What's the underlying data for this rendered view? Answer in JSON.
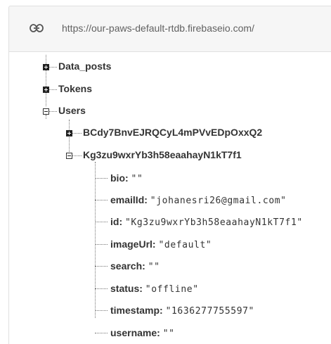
{
  "database": {
    "url": "https://our-paws-default-rtdb.firebaseio.com/"
  },
  "icons": {
    "url_link": "link-icon"
  },
  "tree": {
    "nodes": {
      "data_posts": "Data_posts",
      "tokens": "Tokens",
      "users": "Users",
      "user_1": "BCdy7BnvEJRQCyL4mPVvEDpOxxQ2",
      "user_2": "Kg3zu9wxrYb3h58eaahayN1kT7f1"
    },
    "fields": [
      {
        "key": "bio:",
        "value": "\"\""
      },
      {
        "key": "emailId:",
        "value": "\"johanesri26@gmail.com\""
      },
      {
        "key": "id:",
        "value": "\"Kg3zu9wxrYb3h58eaahayN1kT7f1\""
      },
      {
        "key": "imageUrl:",
        "value": "\"default\""
      },
      {
        "key": "search:",
        "value": "\"\""
      },
      {
        "key": "status:",
        "value": "\"offline\""
      },
      {
        "key": "timestamp:",
        "value": "\"1636277755597\""
      },
      {
        "key": "username:",
        "value": "\"\""
      }
    ]
  }
}
